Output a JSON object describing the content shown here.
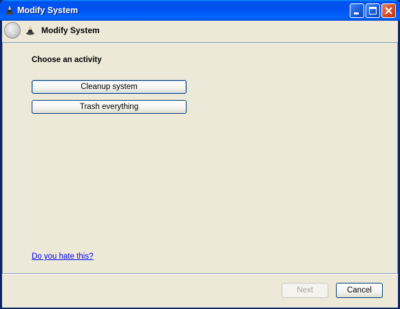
{
  "window": {
    "title": "Modify System",
    "icon": "wizard-hat-icon",
    "controls": [
      "minimize-icon",
      "maximize-icon",
      "close-icon"
    ]
  },
  "header": {
    "back_icon": "back-arrow-icon",
    "icon": "wizard-hat-icon",
    "title": "Modify System"
  },
  "content": {
    "heading": "Choose an activity",
    "buttons": [
      {
        "label": "Cleanup system"
      },
      {
        "label": "Trash everything"
      }
    ],
    "link": "Do you hate this?"
  },
  "footer": {
    "next_label": "Next",
    "next_enabled": false,
    "cancel_label": "Cancel"
  },
  "colors": {
    "titlebar": "#0053ee",
    "window_bg": "#ece9d8",
    "link": "#0000ee"
  }
}
